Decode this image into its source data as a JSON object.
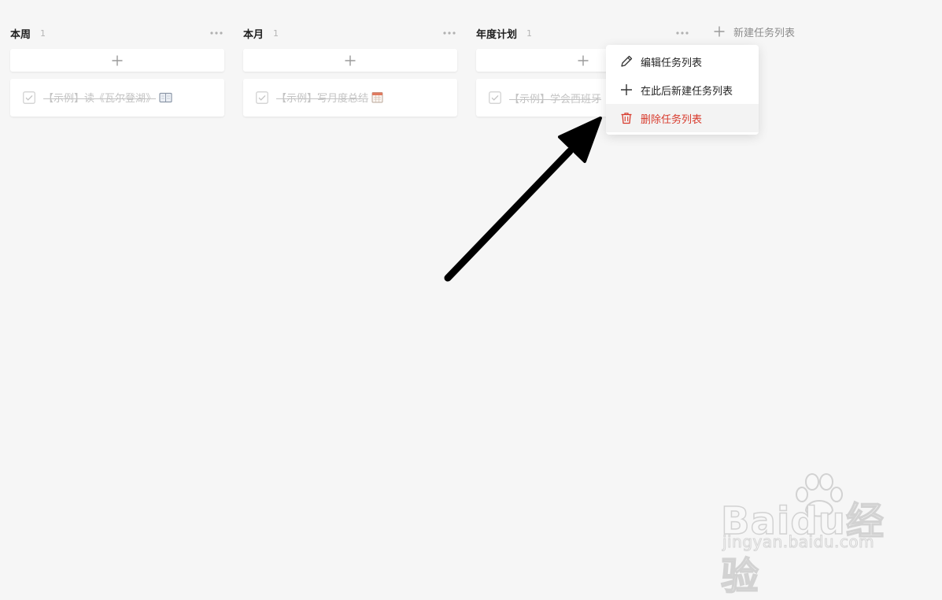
{
  "columns": [
    {
      "title": "本周",
      "count": "1",
      "task": {
        "title": "【示例】读《瓦尔登湖》",
        "emoji": "book-icon"
      }
    },
    {
      "title": "本月",
      "count": "1",
      "task": {
        "title": "【示例】写月度总结",
        "emoji": "calendar-icon"
      }
    },
    {
      "title": "年度计划",
      "count": "1",
      "task": {
        "title": "【示例】学会西班牙",
        "emoji": ""
      }
    }
  ],
  "new_list_label": "新建任务列表",
  "menu": {
    "items": [
      {
        "label": "编辑任务列表",
        "icon": "pencil-icon"
      },
      {
        "label": "在此后新建任务列表",
        "icon": "plus-icon"
      },
      {
        "label": "删除任务列表",
        "icon": "trash-icon"
      }
    ]
  },
  "watermark": {
    "brand": "Baidu经验",
    "url": "jingyan.baidu.com"
  },
  "colors": {
    "background": "#f6f6f6",
    "danger": "#d83b2d",
    "muted_text": "#c3c3c3"
  }
}
